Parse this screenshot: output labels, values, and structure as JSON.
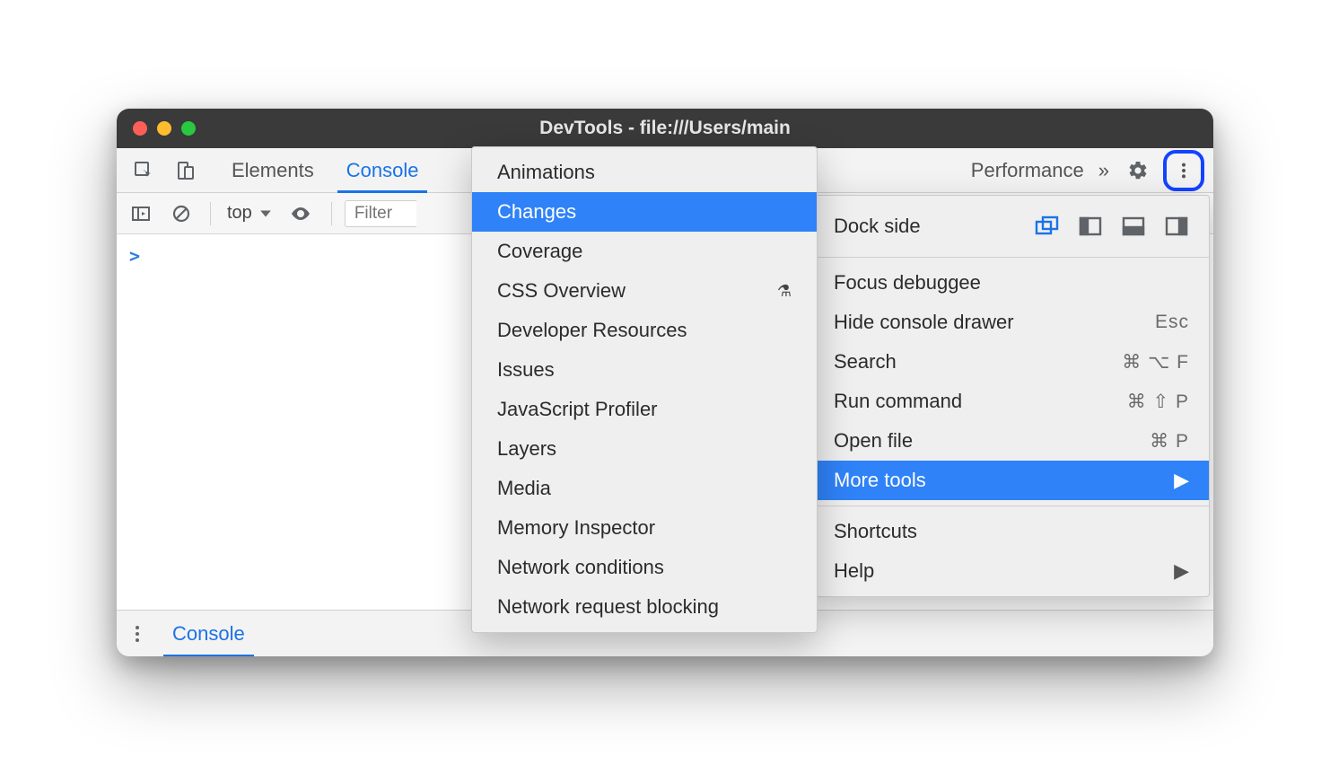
{
  "window": {
    "title": "DevTools - file:///Users/main"
  },
  "tabs": {
    "elements": "Elements",
    "console": "Console",
    "performance": "Performance",
    "overflow": "»"
  },
  "console_toolbar": {
    "context": "top",
    "filter_placeholder": "Filter"
  },
  "console": {
    "prompt": ">"
  },
  "drawer": {
    "tab": "Console"
  },
  "menu": {
    "dock_side": "Dock side",
    "focus_debuggee": "Focus debuggee",
    "hide_console_drawer": "Hide console drawer",
    "hide_console_drawer_sc": "Esc",
    "search": "Search",
    "search_sc": "⌘ ⌥ F",
    "run_command": "Run command",
    "run_command_sc": "⌘ ⇧ P",
    "open_file": "Open file",
    "open_file_sc": "⌘ P",
    "more_tools": "More tools",
    "shortcuts": "Shortcuts",
    "help": "Help"
  },
  "submenu": {
    "animations": "Animations",
    "changes": "Changes",
    "coverage": "Coverage",
    "css_overview": "CSS Overview",
    "developer_resources": "Developer Resources",
    "issues": "Issues",
    "javascript_profiler": "JavaScript Profiler",
    "layers": "Layers",
    "media": "Media",
    "memory_inspector": "Memory Inspector",
    "network_conditions": "Network conditions",
    "network_request_blocking": "Network request blocking"
  }
}
